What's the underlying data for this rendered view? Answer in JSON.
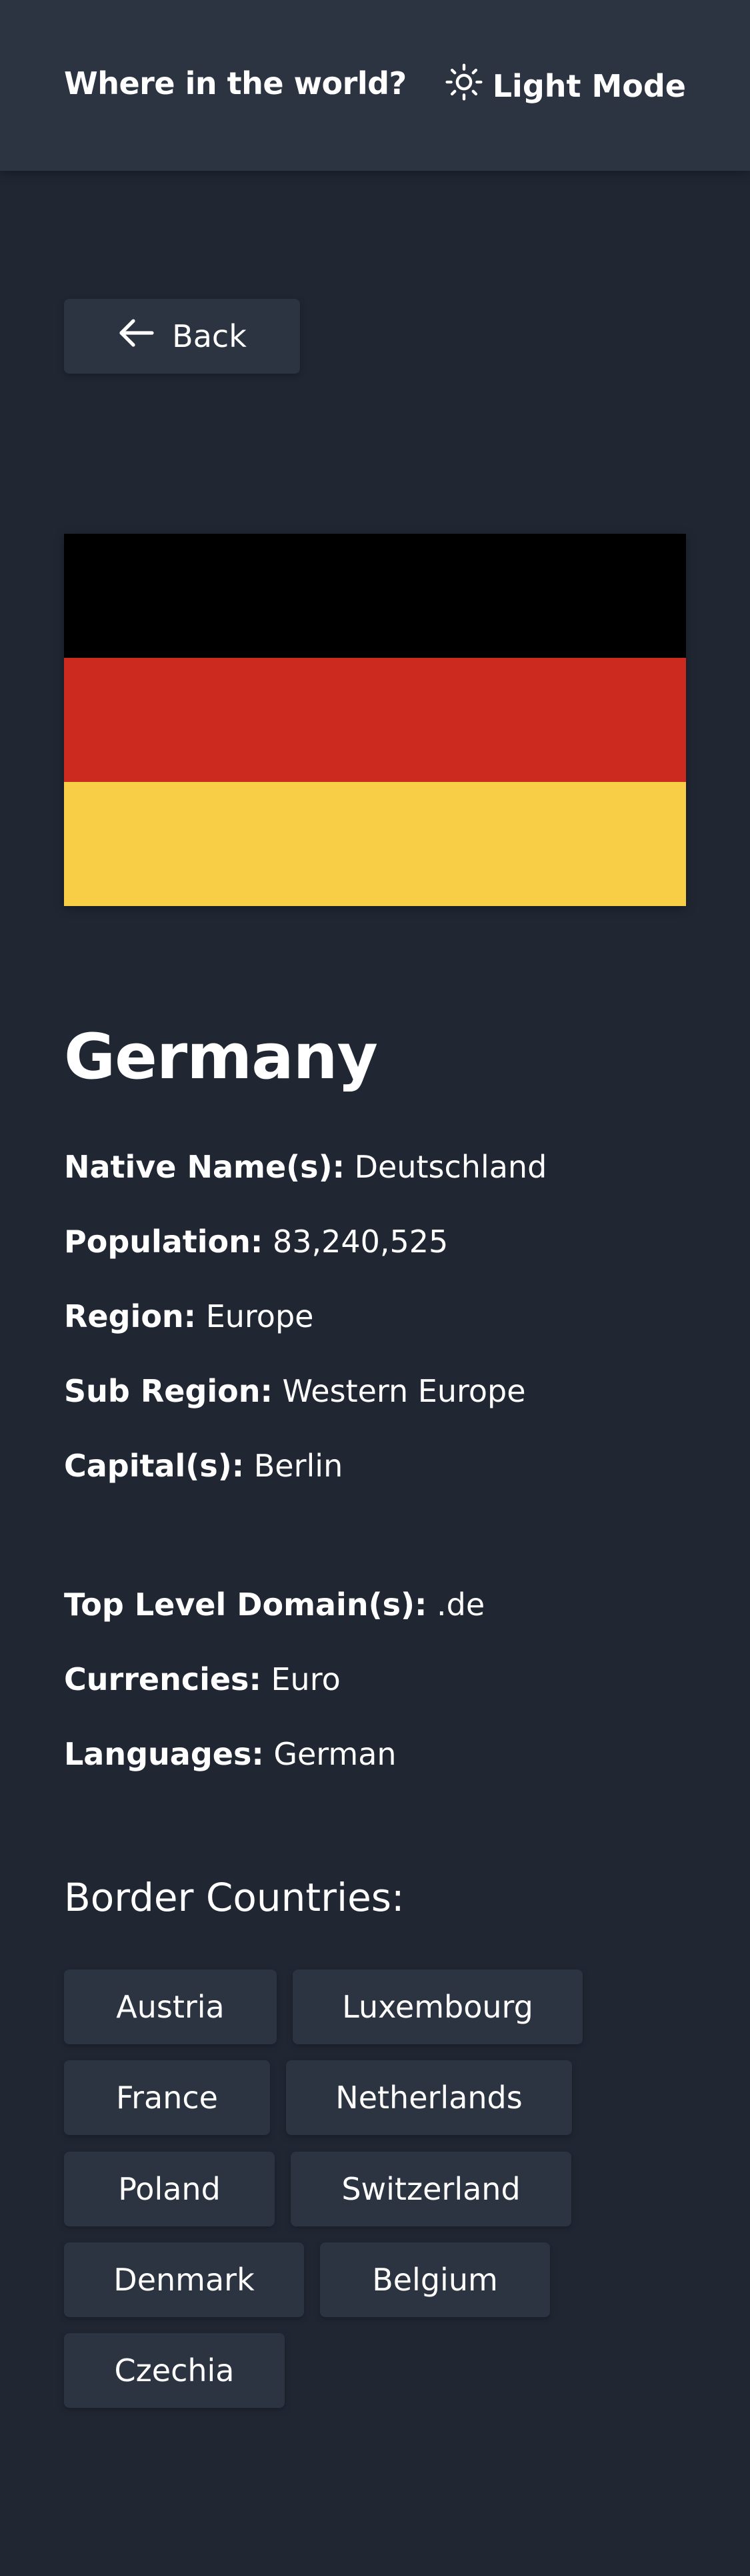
{
  "header": {
    "title": "Where in the world?",
    "theme_toggle_label": "Light Mode",
    "theme_icon": "sun-icon"
  },
  "back_button": {
    "label": "Back",
    "icon": "arrow-left-icon"
  },
  "flag": {
    "colors": [
      "#000000",
      "#cc2a1e",
      "#f8ce46"
    ]
  },
  "country": {
    "name": "Germany",
    "details_primary": [
      {
        "key": "Native Name(s):",
        "value": "Deutschland"
      },
      {
        "key": "Population:",
        "value": "83,240,525"
      },
      {
        "key": "Region:",
        "value": "Europe"
      },
      {
        "key": "Sub Region:",
        "value": "Western Europe"
      },
      {
        "key": "Capital(s):",
        "value": "Berlin"
      }
    ],
    "details_secondary": [
      {
        "key": "Top Level Domain(s):",
        "value": ".de"
      },
      {
        "key": "Currencies:",
        "value": "Euro"
      },
      {
        "key": "Languages:",
        "value": "German"
      }
    ],
    "border_title": "Border Countries:",
    "borders": [
      "Austria",
      "Luxembourg",
      "France",
      "Netherlands",
      "Poland",
      "Switzerland",
      "Denmark",
      "Belgium",
      "Czechia"
    ]
  },
  "colors": {
    "background": "#202733",
    "elements": "#2b3440",
    "text": "#ffffff"
  }
}
